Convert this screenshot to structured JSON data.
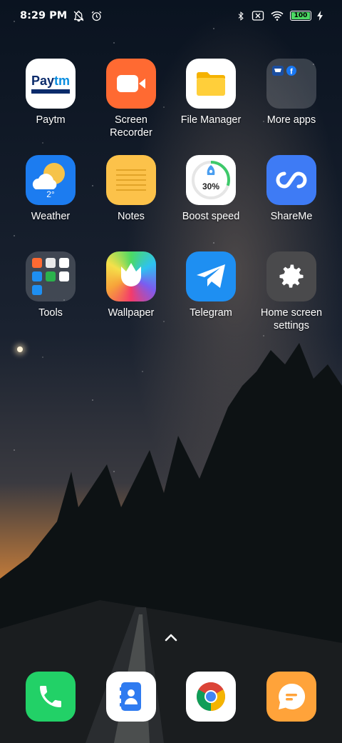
{
  "status_bar": {
    "time": "8:29 PM",
    "battery_level": "100",
    "icons": [
      "notifications-off-icon",
      "alarm-icon",
      "bluetooth-icon",
      "no-sim-icon",
      "wifi-icon",
      "battery-icon",
      "charging-icon"
    ]
  },
  "apps": {
    "paytm": {
      "label": "Paytm",
      "icon_text": "Paytm"
    },
    "screen_recorder": {
      "label": "Screen\nRecorder"
    },
    "file_manager": {
      "label": "File Manager"
    },
    "more_apps": {
      "label": "More apps"
    },
    "weather": {
      "label": "Weather",
      "temp": "2°"
    },
    "notes": {
      "label": "Notes"
    },
    "boost_speed": {
      "label": "Boost speed",
      "percent": "30%",
      "percent_value": 0.3
    },
    "shareme": {
      "label": "ShareMe"
    },
    "tools": {
      "label": "Tools"
    },
    "wallpaper": {
      "label": "Wallpaper"
    },
    "telegram": {
      "label": "Telegram"
    },
    "home_settings": {
      "label": "Home screen\nsettings"
    }
  },
  "dock": [
    "phone",
    "contacts",
    "chrome",
    "messages"
  ],
  "colors": {
    "screen_recorder": "#ff6a32",
    "notes": "#fcc24a",
    "shareme": "#3e7bf5",
    "telegram": "#1e8ff2",
    "weather": "#1c7cf0",
    "phone": "#22d167",
    "messages": "#ffa33a"
  }
}
